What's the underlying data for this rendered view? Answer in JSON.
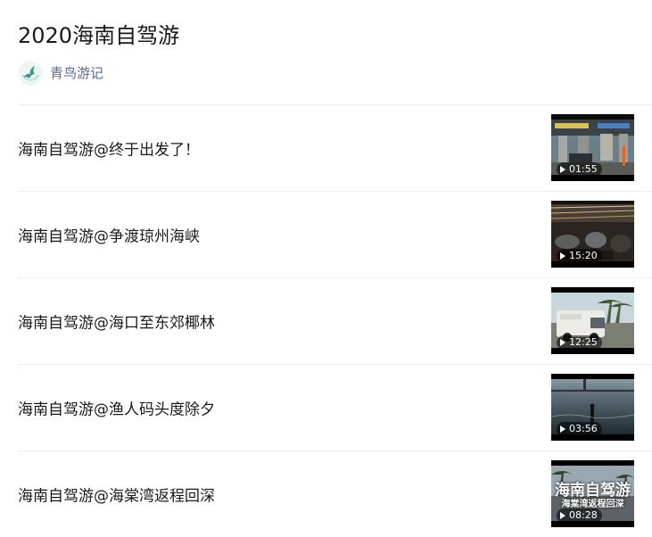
{
  "article": {
    "title": "2020海南自驾游",
    "author": "青鸟游记"
  },
  "videos": [
    {
      "title": "海南自驾游@终于出发了！",
      "duration": "01:55"
    },
    {
      "title": "海南自驾游@争渡琼州海峡",
      "duration": "15:20"
    },
    {
      "title": "海南自驾游@海口至东郊椰林",
      "duration": "12:25"
    },
    {
      "title": "海南自驾游@渔人码头度除夕",
      "duration": "03:56"
    },
    {
      "title": "海南自驾游@海棠湾返程回深",
      "duration": "08:28",
      "overlay_title": "海南自驾游",
      "overlay_subtitle": "海棠湾返程回深"
    }
  ],
  "colors": {
    "author_link": "#576b95",
    "divider": "#ececec"
  }
}
